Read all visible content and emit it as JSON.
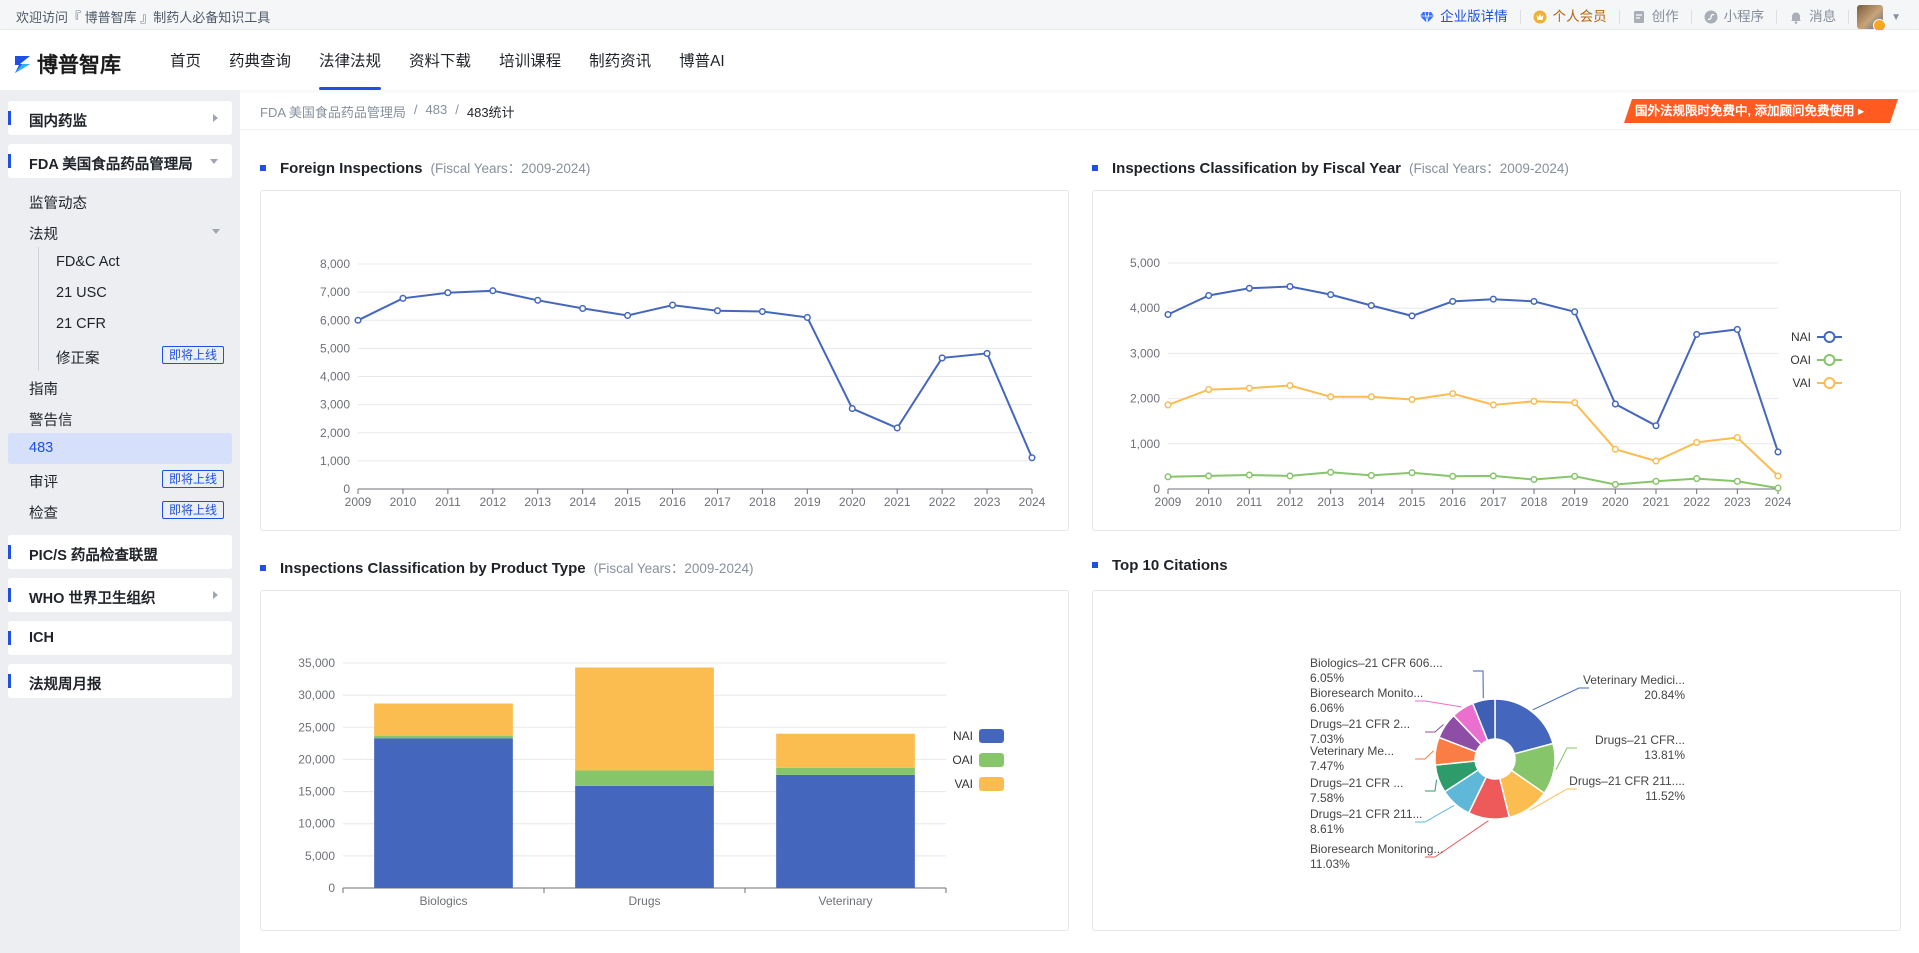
{
  "topbar": {
    "welcome": "欢迎访问『 博普智库 』制药人必备知识工具",
    "enterprise": "企业版详情",
    "vip": "个人会员",
    "create": "创作",
    "miniapp": "小程序",
    "messages": "消息"
  },
  "nav": {
    "logo": "博普智库",
    "tabs": [
      "首页",
      "药典查询",
      "法律法规",
      "资料下载",
      "培训课程",
      "制药资讯",
      "博普AI"
    ],
    "active_index": 2
  },
  "sidebar": {
    "domestic": "国内药监",
    "fda": "FDA 美国食品药品管理局",
    "fda_items": {
      "regulatory_news": "监管动态",
      "laws": "法规",
      "laws_children": [
        "FD&C Act",
        "21 USC",
        "21 CFR",
        "修正案"
      ],
      "guidance": "指南",
      "warning_letters": "警告信",
      "f483": "483",
      "review": "审评",
      "inspection": "检查"
    },
    "coming_soon": "即将上线",
    "pics": "PIC/S 药品检查联盟",
    "who": "WHO 世界卫生组织",
    "ich": "ICH",
    "weekly": "法规周月报"
  },
  "breadcrumb": {
    "root": "FDA 美国食品药品管理局",
    "sep": "/",
    "mid": "483",
    "current": "483统计"
  },
  "promo": "国外法规限时免费中, 添加顾问免费使用",
  "sections": {
    "foreign": {
      "title": "Foreign Inspections",
      "sub": "(Fiscal Years：2009-2024)"
    },
    "fiscal": {
      "title": "Inspections Classification by Fiscal Year",
      "sub": "(Fiscal Years：2009-2024)"
    },
    "product": {
      "title": "Inspections Classification by Product Type",
      "sub": "(Fiscal Years：2009-2024)"
    },
    "citations": {
      "title": "Top 10 Citations",
      "sub": ""
    }
  },
  "colors": {
    "accent": "#1e50e6",
    "nai": "#4467bd",
    "oai": "#86c56a",
    "vai": "#fbbc50"
  },
  "chart_data": [
    {
      "type": "line",
      "x": [
        "2009",
        "2010",
        "2011",
        "2012",
        "2013",
        "2014",
        "2015",
        "2016",
        "2017",
        "2018",
        "2019",
        "2020",
        "2021",
        "2022",
        "2023",
        "2024"
      ],
      "series": [
        {
          "values": [
            6000,
            6780,
            6980,
            7050,
            6710,
            6420,
            6170,
            6540,
            6340,
            6310,
            6100,
            2860,
            2170,
            4660,
            4820,
            1110
          ]
        }
      ],
      "yticks": [
        "0",
        "1,000",
        "2,000",
        "3,000",
        "4,000",
        "5,000",
        "6,000",
        "7,000",
        "8,000"
      ],
      "ylim": [
        0,
        8000
      ],
      "color": "#4467bd"
    },
    {
      "type": "line",
      "x": [
        "2009",
        "2010",
        "2011",
        "2012",
        "2013",
        "2014",
        "2015",
        "2016",
        "2017",
        "2018",
        "2019",
        "2020",
        "2021",
        "2022",
        "2023",
        "2024"
      ],
      "series": [
        {
          "name": "NAI",
          "values": [
            3860,
            4280,
            4440,
            4480,
            4300,
            4060,
            3830,
            4150,
            4200,
            4150,
            3920,
            1880,
            1400,
            3420,
            3530,
            820
          ],
          "color": "#4467bd"
        },
        {
          "name": "OAI",
          "values": [
            270,
            290,
            310,
            290,
            370,
            300,
            360,
            280,
            290,
            210,
            280,
            100,
            170,
            230,
            170,
            20
          ],
          "color": "#86c56a"
        },
        {
          "name": "VAI",
          "values": [
            1860,
            2200,
            2230,
            2290,
            2040,
            2040,
            1980,
            2110,
            1860,
            1940,
            1910,
            880,
            620,
            1030,
            1140,
            290
          ],
          "color": "#fbbc50"
        }
      ],
      "yticks": [
        "0",
        "1,000",
        "2,000",
        "3,000",
        "4,000",
        "5,000"
      ],
      "ylim": [
        0,
        5000
      ],
      "legend": "right"
    },
    {
      "type": "bar",
      "stacked": true,
      "categories": [
        "Biologics",
        "Drugs",
        "Veterinary"
      ],
      "series": [
        {
          "name": "NAI",
          "values": [
            23300,
            15900,
            17600
          ],
          "color": "#4467bd"
        },
        {
          "name": "OAI",
          "values": [
            400,
            2400,
            1100
          ],
          "color": "#86c56a"
        },
        {
          "name": "VAI",
          "values": [
            5000,
            16000,
            5300
          ],
          "color": "#fbbc50"
        }
      ],
      "yticks": [
        "0",
        "5,000",
        "10,000",
        "15,000",
        "20,000",
        "25,000",
        "30,000",
        "35,000"
      ],
      "ylim": [
        0,
        35000
      ],
      "legend": "right"
    },
    {
      "type": "pie",
      "slices": [
        {
          "label": "Veterinary Medici...",
          "pct": "20.84%",
          "value": 20.84,
          "color": "#4467bd"
        },
        {
          "label": "Drugs–21 CFR...",
          "pct": "13.81%",
          "value": 13.81,
          "color": "#86c56a"
        },
        {
          "label": "Drugs–21 CFR 211....",
          "pct": "11.52%",
          "value": 11.52,
          "color": "#fbbc50"
        },
        {
          "label": "Bioresearch Monitoring...",
          "pct": "11.03%",
          "value": 11.03,
          "color": "#ee5a5a"
        },
        {
          "label": "Drugs–21 CFR 211...",
          "pct": "8.61%",
          "value": 8.61,
          "color": "#5fb8d8"
        },
        {
          "label": "Drugs–21 CFR ...",
          "pct": "7.58%",
          "value": 7.58,
          "color": "#2e9b6a"
        },
        {
          "label": "Veterinary Me...",
          "pct": "7.47%",
          "value": 7.47,
          "color": "#fa7d45"
        },
        {
          "label": "Drugs–21 CFR 2...",
          "pct": "7.03%",
          "value": 7.03,
          "color": "#8e4ea5"
        },
        {
          "label": "Bioresearch Monito...",
          "pct": "6.06%",
          "value": 6.06,
          "color": "#ea6fce"
        },
        {
          "label": "Biologics–21 CFR 606....",
          "pct": "6.05%",
          "value": 6.05,
          "color": "#3f5fb4"
        }
      ]
    }
  ]
}
